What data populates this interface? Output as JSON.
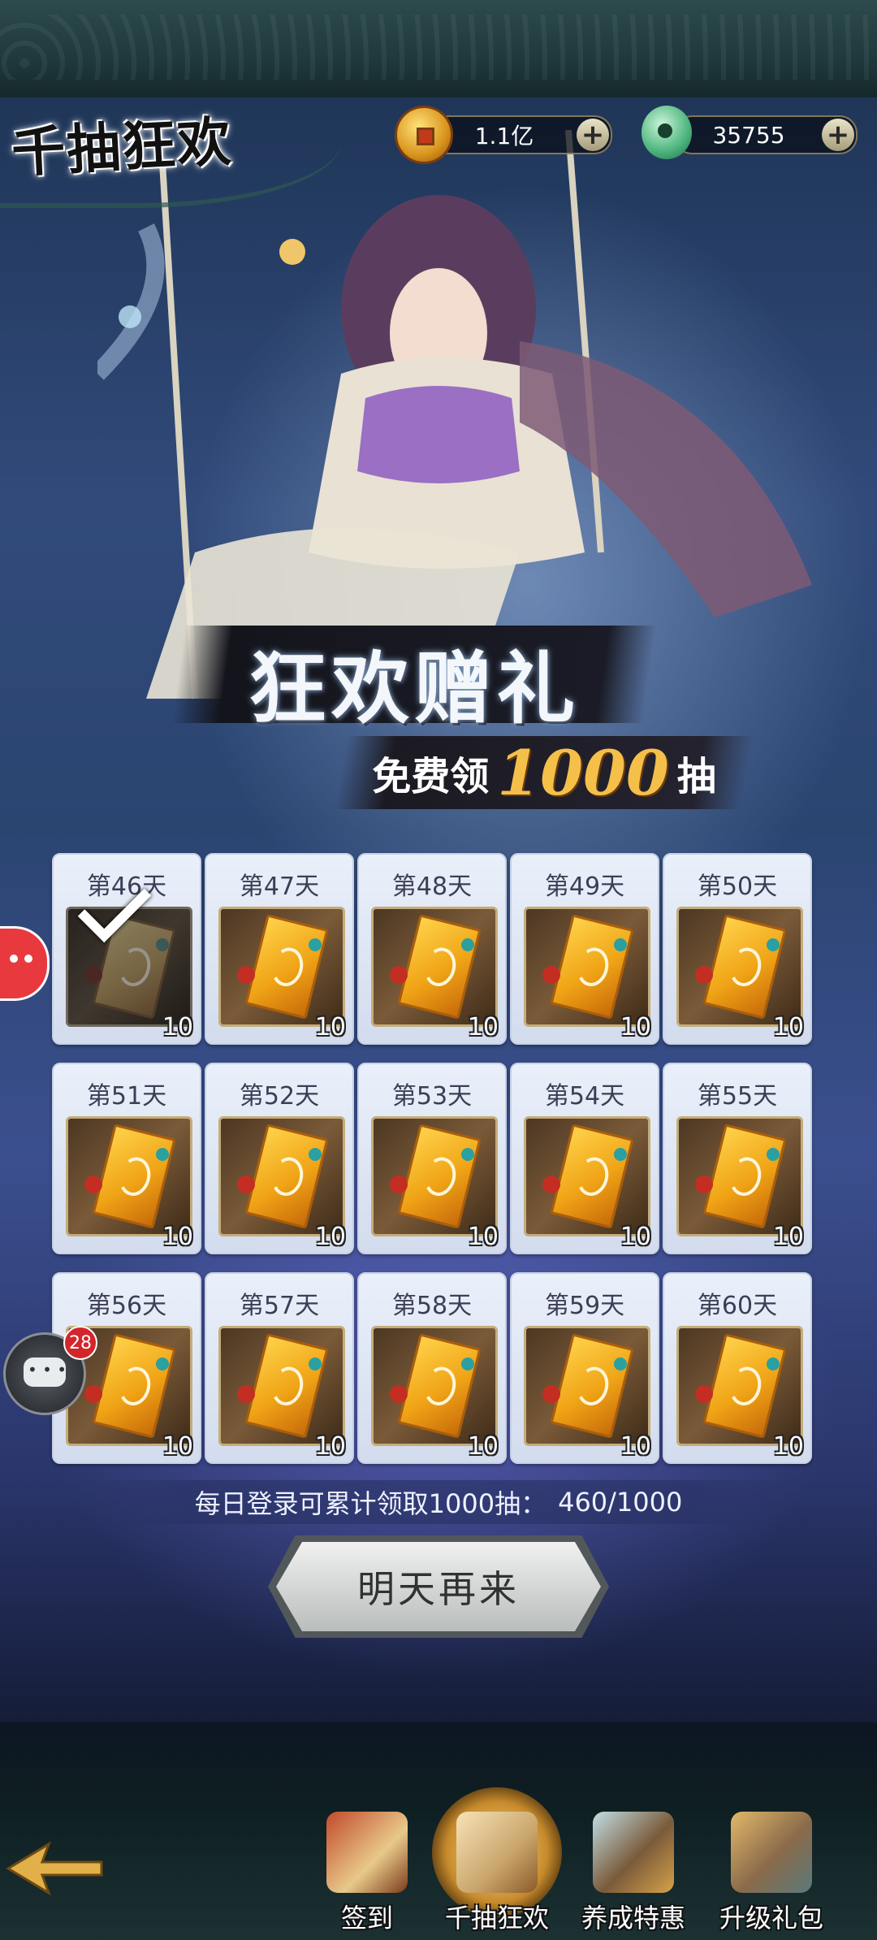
{
  "title": "千抽狂欢",
  "currency": {
    "coins": "1.1亿",
    "jade": "35755",
    "plus": "+"
  },
  "banner": {
    "main": "狂欢赠礼",
    "sub_prefix": "免费领",
    "sub_number": "1000",
    "sub_suffix": "抽"
  },
  "rewards": [
    {
      "day": "第46天",
      "qty": "10",
      "claimed": true
    },
    {
      "day": "第47天",
      "qty": "10",
      "claimed": false
    },
    {
      "day": "第48天",
      "qty": "10",
      "claimed": false
    },
    {
      "day": "第49天",
      "qty": "10",
      "claimed": false
    },
    {
      "day": "第50天",
      "qty": "10",
      "claimed": false
    },
    {
      "day": "第51天",
      "qty": "10",
      "claimed": false
    },
    {
      "day": "第52天",
      "qty": "10",
      "claimed": false
    },
    {
      "day": "第53天",
      "qty": "10",
      "claimed": false
    },
    {
      "day": "第54天",
      "qty": "10",
      "claimed": false
    },
    {
      "day": "第55天",
      "qty": "10",
      "claimed": false
    },
    {
      "day": "第56天",
      "qty": "10",
      "claimed": false
    },
    {
      "day": "第57天",
      "qty": "10",
      "claimed": false
    },
    {
      "day": "第58天",
      "qty": "10",
      "claimed": false
    },
    {
      "day": "第59天",
      "qty": "10",
      "claimed": false
    },
    {
      "day": "第60天",
      "qty": "10",
      "claimed": false
    }
  ],
  "progress": {
    "label": "每日登录可累计领取1000抽：",
    "value": "460/1000"
  },
  "action_button": "明天再来",
  "chat_badge": "28",
  "nav": [
    {
      "label": "签到",
      "icon": "sign-in-scroll-icon",
      "active": false
    },
    {
      "label": "千抽狂欢",
      "icon": "gift-chest-icon",
      "active": true
    },
    {
      "label": "养成特惠",
      "icon": "treasure-chest-icon",
      "active": false
    },
    {
      "label": "升级礼包",
      "icon": "pot-gift-icon",
      "active": false
    }
  ]
}
